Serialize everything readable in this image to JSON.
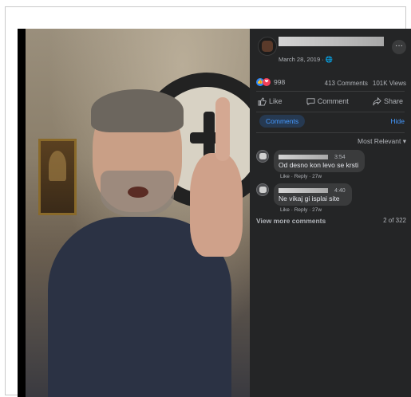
{
  "post": {
    "date": "March 28, 2019 · 🌐",
    "more_label": "···"
  },
  "stats": {
    "reactions": "998",
    "comments": "413 Comments",
    "views": "101K Views"
  },
  "actions": {
    "like": "Like",
    "comment": "Comment",
    "share": "Share"
  },
  "tabs": {
    "comments": "Comments",
    "hide": "Hide"
  },
  "sort": {
    "label": "Most Relevant ▾"
  },
  "comments": [
    {
      "time": "3:54",
      "text": "Od desno kon levo se krsti",
      "actions": "Like · Reply · 27w"
    },
    {
      "time": "4:40",
      "text": "Ne vikaj gi isplai site",
      "actions": "Like · Reply · 27w"
    }
  ],
  "footer": {
    "view_more": "View more comments",
    "count": "2 of 322"
  },
  "icons": {
    "like_reaction": "thumbs-up-icon",
    "love_reaction": "heart-icon",
    "like_action": "thumbs-up-outline-icon",
    "comment_action": "speech-bubble-icon",
    "share_action": "share-arrow-icon"
  },
  "colors": {
    "panel_bg": "#242526",
    "accent": "#4599ff",
    "like_blue": "#2d88ff",
    "love_red": "#f33e58"
  }
}
